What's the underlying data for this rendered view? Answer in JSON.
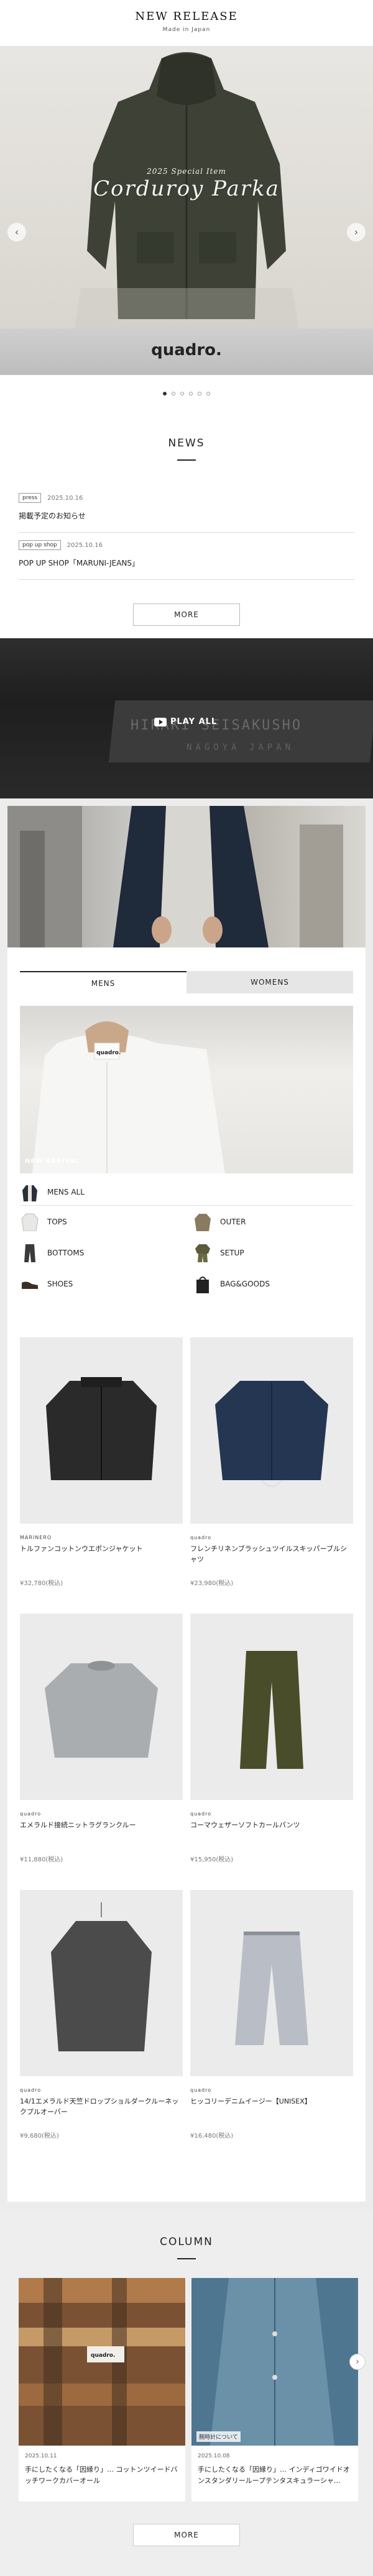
{
  "release": {
    "title": "NEW RELEASE",
    "subtitle": "Made in Japan",
    "slide": {
      "caption_small": "2025 Special Item",
      "caption": "Corduroy Parka",
      "brand": "quadro."
    },
    "slide_count": 6,
    "active_slide": 1
  },
  "news": {
    "title": "NEWS",
    "items": [
      {
        "tag": "press",
        "date": "2025.10.16",
        "text": "掲載予定のお知らせ"
      },
      {
        "tag": "pop up shop",
        "date": "2025.10.16",
        "text": "POP UP SHOP「MARUNI-JEANS」"
      }
    ],
    "more": "MORE"
  },
  "video": {
    "play_label": "PLAY ALL",
    "plate_line1": "HIRAKI SEISAKUSHO",
    "plate_line2": "NAGOYA  JAPAN"
  },
  "catalog": {
    "tabs": [
      "MENS",
      "WOMENS"
    ],
    "active_tab": "MENS",
    "new_arrival": "NEW ARRIVAL",
    "mens_all": "MENS ALL",
    "categories": [
      "TOPS",
      "OUTER",
      "BOTTOMS",
      "SETUP",
      "SHOES",
      "BAG&GOODS"
    ],
    "products": [
      {
        "brand": "MARINERO",
        "name": "トルファンコットンウエポンジャケット",
        "price": "¥32,780(税込)"
      },
      {
        "brand": "quadro",
        "name": "フレンチリネンブラッシュツイルスキッパーブルシャツ",
        "price": "¥23,980(税込)"
      },
      {
        "brand": "quadro",
        "name": "エメラルド接続ニットラグランクルー",
        "price": "¥11,880(税込)"
      },
      {
        "brand": "quadro",
        "name": "コーマウェザーソフトカールパンツ",
        "price": "¥15,950(税込)"
      },
      {
        "brand": "quadro",
        "name": "14/1エメラルド天竺ドロップショルダークルーネックプルオーバー",
        "price": "¥9,680(税込)"
      },
      {
        "brand": "quadro",
        "name": "ヒッコリーデニムイージー【UNISEX】",
        "price": "¥16,480(税込)"
      }
    ]
  },
  "column": {
    "title": "COLUMN",
    "cards": [
      {
        "date": "2025.10.11",
        "text": "手にしたくなる「因縁り」… コットンツイードバッチワークカバーオール",
        "badge": ""
      },
      {
        "date": "2025.10.08",
        "text": "手にしたくなる「因縁り」… インディゴワイドオンスタンダリーループテンタスキュラーシャ…",
        "badge": "腕時計について"
      }
    ],
    "more": "MORE"
  },
  "colors": {
    "accent": "#222222",
    "panel": "#ececec"
  }
}
